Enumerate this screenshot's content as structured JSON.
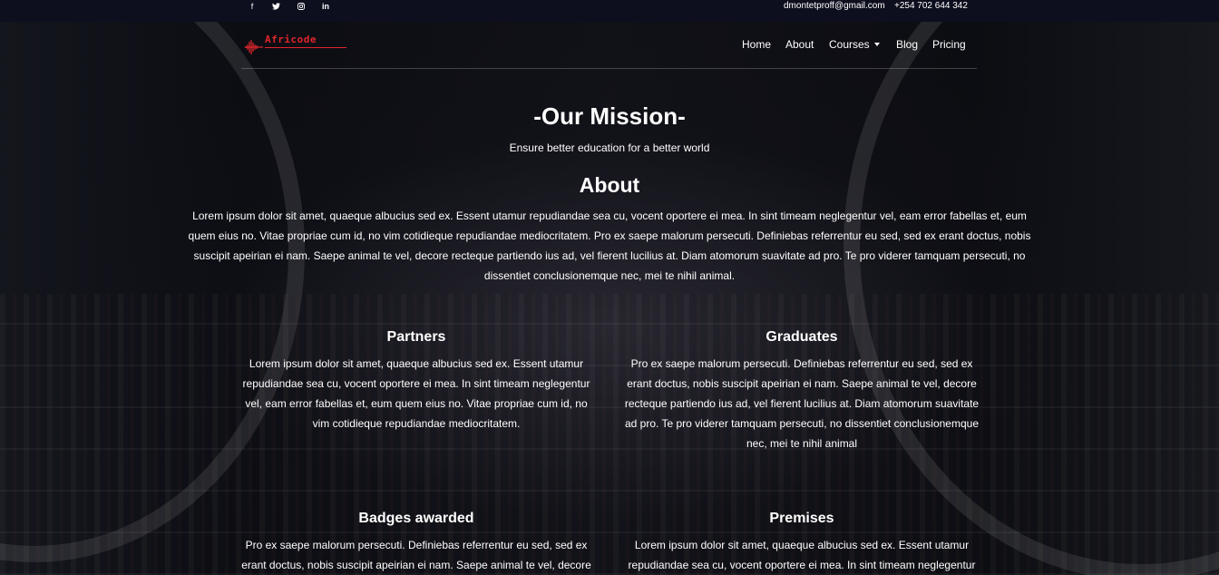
{
  "topbar": {
    "social": [
      {
        "name": "facebook-icon",
        "glyph": "f"
      },
      {
        "name": "twitter-icon",
        "glyph": "🐦"
      },
      {
        "name": "instagram-icon",
        "glyph": "◎"
      },
      {
        "name": "linkedin-icon",
        "glyph": "in"
      }
    ],
    "email": "dmontetproff@gmail.com",
    "phone": "+254 702 644 342"
  },
  "brand": {
    "name": "Africode",
    "color": "#e0262b"
  },
  "nav": {
    "home": "Home",
    "about": "About",
    "courses": "Courses",
    "blog": "Blog",
    "pricing": "Pricing"
  },
  "hero": {
    "title": "-Our Mission-",
    "subtitle": "Ensure better education for a better world"
  },
  "about": {
    "title": "About",
    "body": "Lorem ipsum dolor sit amet, quaeque albucius sed ex. Essent utamur repudiandae sea cu, vocent oportere ei mea. In sint timeam neglegentur vel, eam error fabellas et, eum quem eius no. Vitae propriae cum id, no vim cotidieque repudiandae mediocritatem. Pro ex saepe malorum persecuti. Definiebas referrentur eu sed, sed ex erant doctus, nobis suscipit apeirian ei nam. Saepe animal te vel, decore recteque partiendo ius ad, vel fierent lucilius at. Diam atomorum suavitate ad pro. Te pro viderer tamquam persecuti, no dissentiet conclusionemque nec, mei te nihil animal."
  },
  "cards": {
    "partners": {
      "title": "Partners",
      "body": "Lorem ipsum dolor sit amet, quaeque albucius sed ex. Essent utamur repudiandae sea cu, vocent oportere ei mea. In sint timeam neglegentur vel, eam error fabellas et, eum quem eius no. Vitae propriae cum id, no vim cotidieque repudiandae mediocritatem."
    },
    "graduates": {
      "title": "Graduates",
      "body": "Pro ex saepe malorum persecuti. Definiebas referrentur eu sed, sed ex erant doctus, nobis suscipit apeirian ei nam. Saepe animal te vel, decore recteque partiendo ius ad, vel fierent lucilius at. Diam atomorum suavitate ad pro. Te pro viderer tamquam persecuti, no dissentiet conclusionemque nec, mei te nihil animal"
    },
    "badges": {
      "title": "Badges awarded",
      "body": "Pro ex saepe malorum persecuti. Definiebas referrentur eu sed, sed ex erant doctus, nobis suscipit apeirian ei nam. Saepe animal te vel, decore"
    },
    "premises": {
      "title": "Premises",
      "body": "Lorem ipsum dolor sit amet, quaeque albucius sed ex. Essent utamur repudiandae sea cu, vocent oportere ei mea. In sint timeam neglegentur"
    }
  }
}
